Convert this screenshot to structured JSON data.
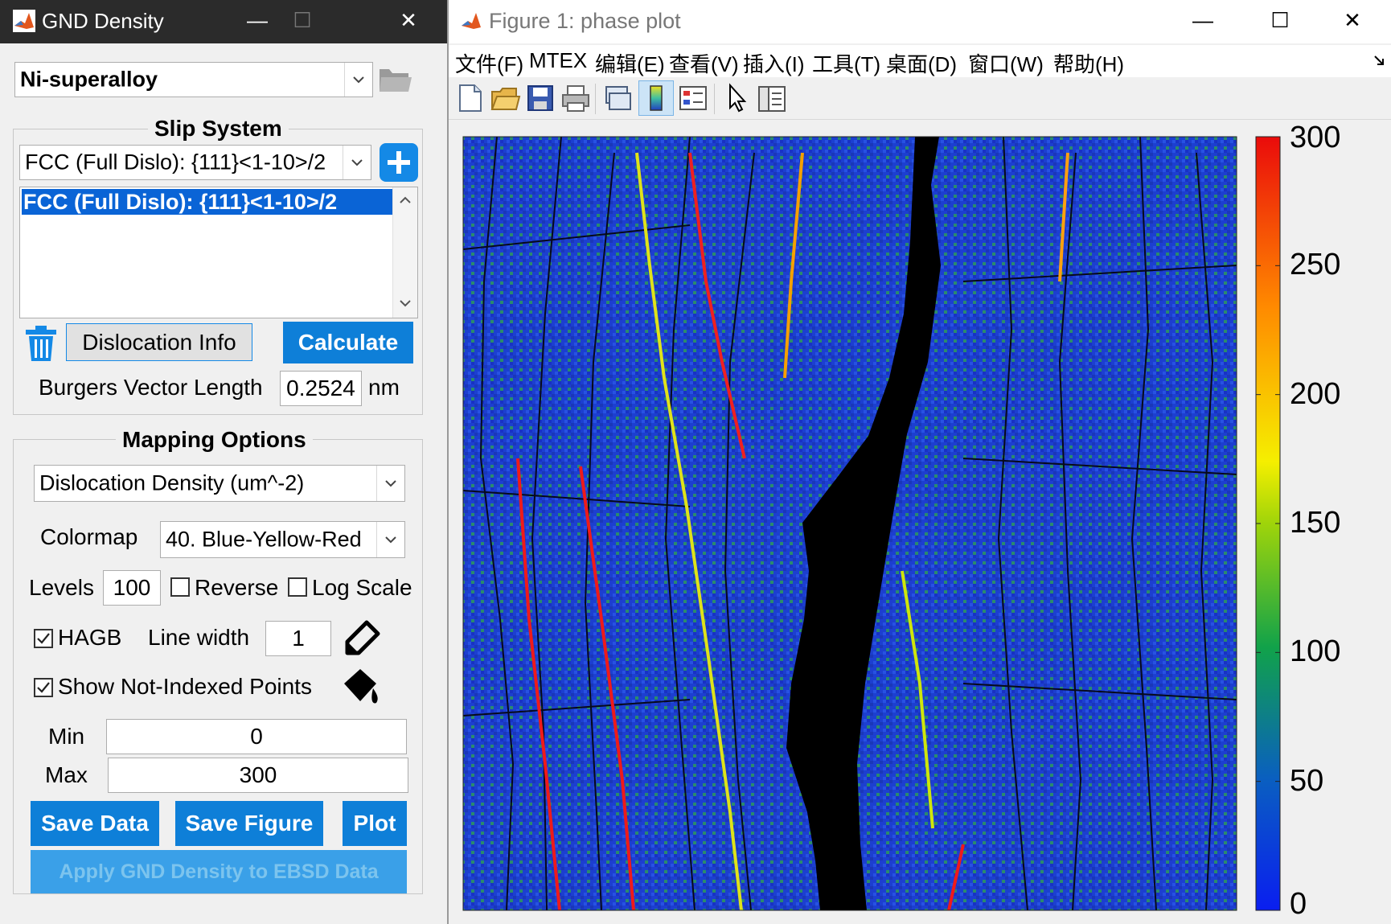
{
  "gnd": {
    "title": "GND Density",
    "material": "Ni-superalloy",
    "slip_system": {
      "title": "Slip System",
      "dropdown": "FCC (Full Dislo): {111}<1-10>/2",
      "list": [
        "FCC (Full Dislo): {111}<1-10>/2"
      ],
      "dislocation_info": "Dislocation Info",
      "calculate": "Calculate",
      "burgers_label": "Burgers Vector Length",
      "burgers_value": "0.2524",
      "burgers_unit": "nm"
    },
    "mapping": {
      "title": "Mapping Options",
      "quantity": "Dislocation Density (um^-2)",
      "colormap_label": "Colormap",
      "colormap_value": "40. Blue-Yellow-Red",
      "levels_label": "Levels",
      "levels_value": "100",
      "reverse_label": "Reverse",
      "reverse_checked": false,
      "log_label": "Log Scale",
      "log_checked": false,
      "hagb_label": "HAGB",
      "hagb_checked": true,
      "line_width_label": "Line width",
      "line_width_value": "1",
      "not_indexed_label": "Show Not-Indexed Points",
      "not_indexed_checked": true,
      "min_label": "Min",
      "min_value": "0",
      "max_label": "Max",
      "max_value": "300"
    },
    "buttons": {
      "save_data": "Save Data",
      "save_figure": "Save Figure",
      "plot": "Plot",
      "apply": "Apply GND Density to EBSD Data"
    }
  },
  "figure": {
    "title": "Figure 1: phase plot",
    "menu": [
      "文件(F)",
      "MTEX",
      "编辑(E)",
      "查看(V)",
      "插入(I)",
      "工具(T)",
      "桌面(D)",
      "窗口(W)",
      "帮助(H)"
    ],
    "colorbar": {
      "ticks": [
        "300",
        "250",
        "200",
        "150",
        "100",
        "50",
        "0"
      ],
      "min": 0,
      "max": 300
    }
  },
  "colors": {
    "accent": "#0e7fd8",
    "selection": "#0a64d6",
    "map_background": "#1a3fd1",
    "pore": "#000000"
  }
}
